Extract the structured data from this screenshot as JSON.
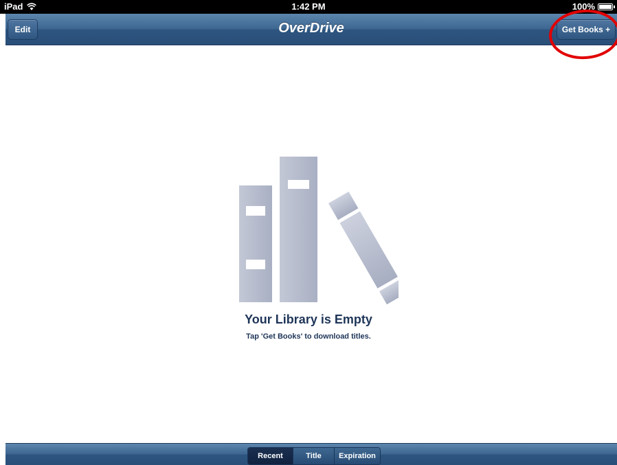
{
  "status_bar": {
    "device": "iPad",
    "time": "1:42 PM",
    "battery": "100%",
    "battery_level": 1.0
  },
  "nav": {
    "title": "OverDrive",
    "edit_label": "Edit",
    "get_books_label": "Get Books +"
  },
  "empty_state": {
    "title": "Your Library is Empty",
    "subtitle": "Tap 'Get Books' to download titles."
  },
  "sort": {
    "segments": [
      "Recent",
      "Title",
      "Expiration"
    ],
    "selected": "Recent"
  },
  "colors": {
    "nav_blue": "#3c6590",
    "highlight_red": "#e10000",
    "text_navy": "#1e3558"
  }
}
